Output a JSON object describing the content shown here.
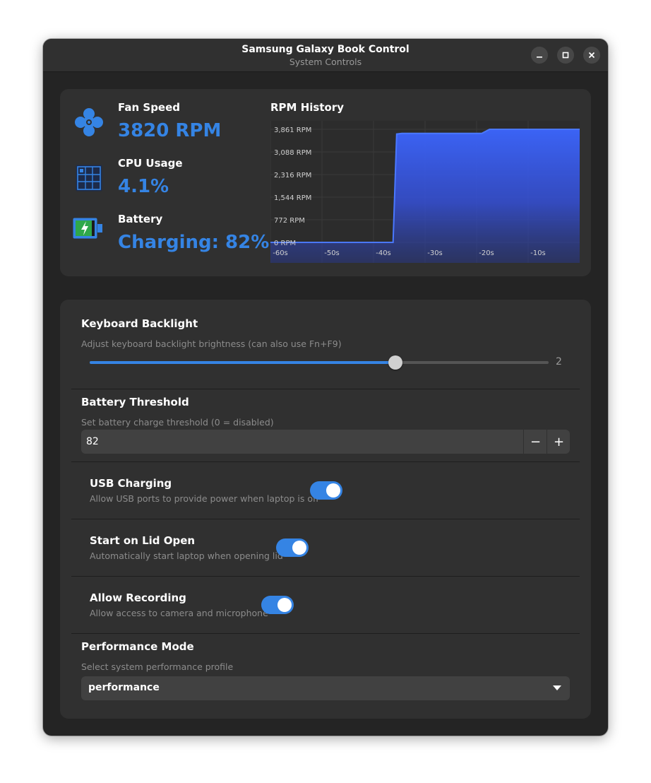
{
  "window": {
    "title": "Samsung Galaxy Book Control",
    "subtitle": "System Controls"
  },
  "stats": {
    "fan": {
      "label": "Fan Speed",
      "value": "3820 RPM"
    },
    "cpu": {
      "label": "CPU Usage",
      "value": "4.1%"
    },
    "battery": {
      "label": "Battery",
      "value": "Charging: 82%"
    }
  },
  "chart_title": "RPM History",
  "chart_data": {
    "type": "area",
    "title": "RPM History",
    "y_ticks": [
      "3,861 RPM",
      "3,088 RPM",
      "2,316 RPM",
      "1,544 RPM",
      "772 RPM",
      "0 RPM"
    ],
    "x_ticks": [
      "-60s",
      "-50s",
      "-40s",
      "-30s",
      "-20s",
      "-10s"
    ],
    "ylim": [
      0,
      3861
    ],
    "xlim": [
      -60,
      0
    ],
    "x": [
      -60,
      -36.2,
      -35.5,
      -34.5,
      -19,
      -17.5,
      0
    ],
    "y": [
      0,
      0,
      3700,
      3720,
      3720,
      3861,
      3861
    ],
    "grid": true,
    "color": "#3b63f5"
  },
  "keyboard_backlight": {
    "title": "Keyboard Backlight",
    "subtitle": "Adjust keyboard backlight brightness (can also use Fn+F9)",
    "value": "2",
    "fraction": 0.666
  },
  "battery_threshold": {
    "title": "Battery Threshold",
    "subtitle": "Set battery charge threshold (0 = disabled)",
    "value": "82",
    "minus": "−",
    "plus": "+"
  },
  "usb_charging": {
    "title": "USB Charging",
    "subtitle": "Allow USB ports to provide power when laptop is off",
    "on": true
  },
  "lid_open": {
    "title": "Start on Lid Open",
    "subtitle": "Automatically start laptop when opening lid",
    "on": true
  },
  "recording": {
    "title": "Allow Recording",
    "subtitle": "Allow access to camera and microphone",
    "on": true
  },
  "performance": {
    "title": "Performance Mode",
    "subtitle": "Select system performance profile",
    "value": "performance"
  },
  "colors": {
    "accent": "#3584e4",
    "chart_fill": "#3b63f5",
    "window_bg": "#242424",
    "card_bg": "#303030"
  }
}
